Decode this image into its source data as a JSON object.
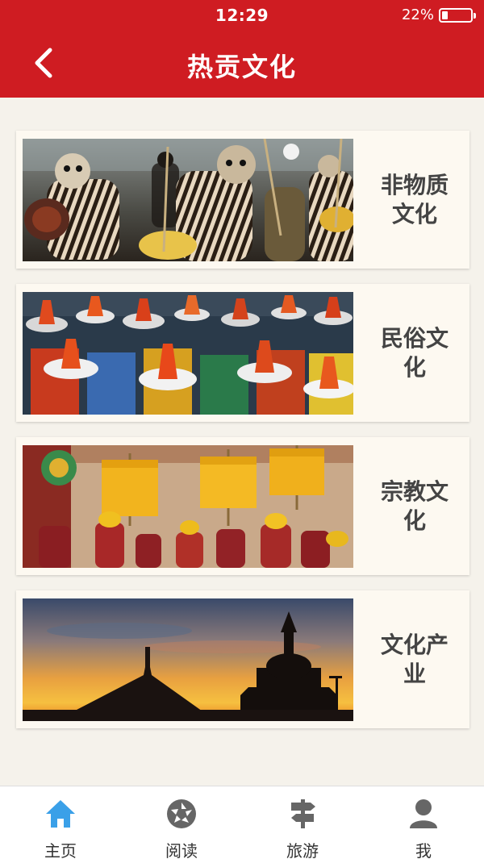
{
  "status": {
    "time": "12:29",
    "battery_text": "22%",
    "battery_level": 0.22
  },
  "header": {
    "title": "热贡文化",
    "back_icon": "chevron-left-icon"
  },
  "categories": [
    {
      "label": "非物质文化",
      "image": "masked-dancers-photo"
    },
    {
      "label": "民俗文化",
      "image": "festival-crowd-hats-photo"
    },
    {
      "label": "宗教文化",
      "image": "monks-parasols-ceremony-photo"
    },
    {
      "label": "文化产业",
      "image": "stupa-sunset-silhouette-photo"
    }
  ],
  "tabbar": {
    "items": [
      {
        "label": "主页",
        "icon": "home-icon",
        "active": true
      },
      {
        "label": "阅读",
        "icon": "aperture-icon",
        "active": false
      },
      {
        "label": "旅游",
        "icon": "signpost-icon",
        "active": false
      },
      {
        "label": "我",
        "icon": "user-icon",
        "active": false
      }
    ]
  },
  "colors": {
    "header_bg": "#cf1c22",
    "active_tab": "#3aa0e8",
    "inactive_tab": "#666666",
    "page_bg": "#f5f2eb"
  }
}
